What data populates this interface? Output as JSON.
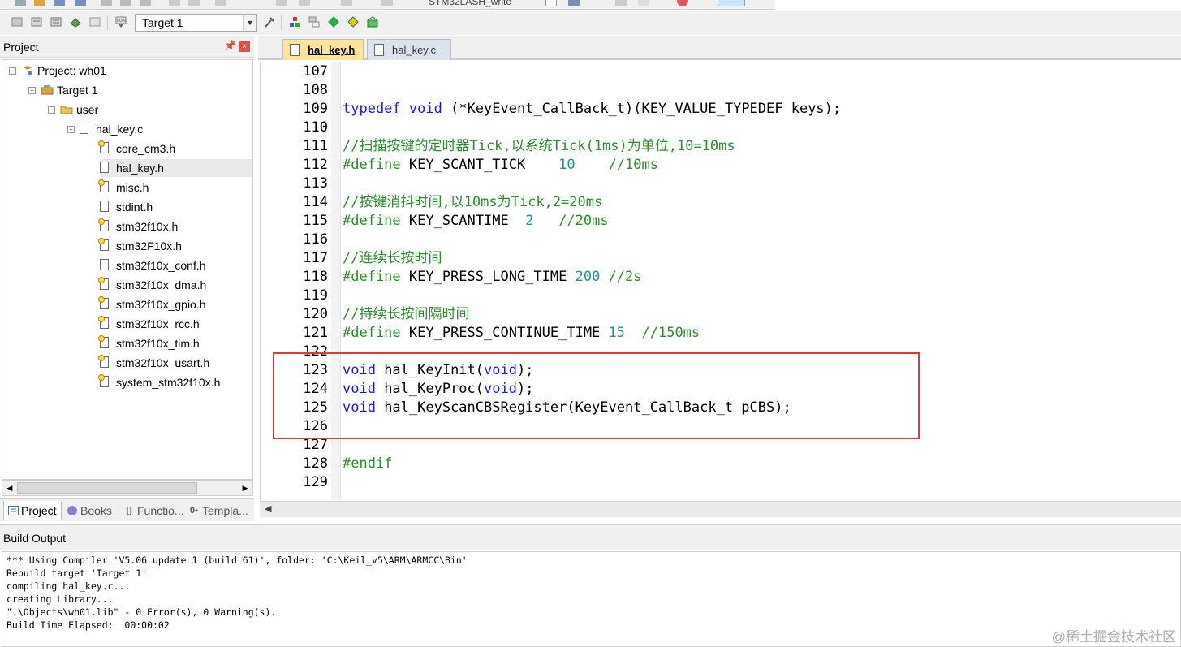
{
  "toolbar": {
    "partial_label": "STM32LASH_write",
    "target_select": "Target 1"
  },
  "project_panel": {
    "title": "Project",
    "pin": "Ŵ",
    "close": "×",
    "tree": {
      "project": "Project: wh01",
      "target": "Target 1",
      "group": "user",
      "source": "hal_key.c",
      "headers": [
        {
          "name": "core_cm3.h",
          "key": true
        },
        {
          "name": "hal_key.h",
          "key": false
        },
        {
          "name": "misc.h",
          "key": true
        },
        {
          "name": "stdint.h",
          "key": false
        },
        {
          "name": "stm32f10x.h",
          "key": true
        },
        {
          "name": "stm32F10x.h",
          "key": true
        },
        {
          "name": "stm32f10x_conf.h",
          "key": false
        },
        {
          "name": "stm32f10x_dma.h",
          "key": true
        },
        {
          "name": "stm32f10x_gpio.h",
          "key": true
        },
        {
          "name": "stm32f10x_rcc.h",
          "key": true
        },
        {
          "name": "stm32f10x_tim.h",
          "key": true
        },
        {
          "name": "stm32f10x_usart.h",
          "key": true
        },
        {
          "name": "system_stm32f10x.h",
          "key": true
        }
      ],
      "selected": "hal_key.h"
    },
    "tabs": [
      "Project",
      "Books",
      "Functio...",
      "Templa..."
    ]
  },
  "editor": {
    "tabs": [
      {
        "label": "hal_key.h",
        "active": true
      },
      {
        "label": "hal_key.c",
        "active": false
      }
    ],
    "lines": [
      {
        "n": "107",
        "t": ""
      },
      {
        "n": "108",
        "t": ""
      },
      {
        "n": "109",
        "t": "typedef void (*KeyEvent_CallBack_t)(KEY_VALUE_TYPEDEF keys);"
      },
      {
        "n": "110",
        "t": ""
      },
      {
        "n": "111",
        "t": "//扫描按键的定时器Tick,以系统Tick(1ms)为单位,10=10ms"
      },
      {
        "n": "112",
        "t": "#define KEY_SCANT_TICK    10    //10ms"
      },
      {
        "n": "113",
        "t": ""
      },
      {
        "n": "114",
        "t": "//按键消抖时间,以10ms为Tick,2=20ms"
      },
      {
        "n": "115",
        "t": "#define KEY_SCANTIME  2   //20ms"
      },
      {
        "n": "116",
        "t": ""
      },
      {
        "n": "117",
        "t": "//连续长按时间"
      },
      {
        "n": "118",
        "t": "#define KEY_PRESS_LONG_TIME 200 //2s"
      },
      {
        "n": "119",
        "t": ""
      },
      {
        "n": "120",
        "t": "//持续长按间隔时间"
      },
      {
        "n": "121",
        "t": "#define KEY_PRESS_CONTINUE_TIME 15  //150ms"
      },
      {
        "n": "122",
        "t": ""
      },
      {
        "n": "123",
        "t": "void hal_KeyInit(void);"
      },
      {
        "n": "124",
        "t": "void hal_KeyProc(void);"
      },
      {
        "n": "125",
        "t": "void hal_KeyScanCBSRegister(KeyEvent_CallBack_t pCBS);"
      },
      {
        "n": "126",
        "t": ""
      },
      {
        "n": "127",
        "t": ""
      },
      {
        "n": "128",
        "t": "#endif"
      },
      {
        "n": "129",
        "t": ""
      }
    ],
    "highlight_color": "#e03a3a"
  },
  "build_output": {
    "title": "Build Output",
    "lines": [
      "*** Using Compiler 'V5.06 update 1 (build 61)', folder: 'C:\\Keil_v5\\ARM\\ARMCC\\Bin'",
      "Rebuild target 'Target 1'",
      "compiling hal_key.c...",
      "creating Library...",
      "\".\\Objects\\wh01.lib\" - 0 Error(s), 0 Warning(s).",
      "Build Time Elapsed:  00:00:02"
    ]
  },
  "watermark": "@稀土掘金技术社区",
  "colors": {
    "keyword": "#1a1ae6",
    "comment": "#2e8b2e",
    "number": "#2a8f8f",
    "active_tab": "#fce59a"
  }
}
